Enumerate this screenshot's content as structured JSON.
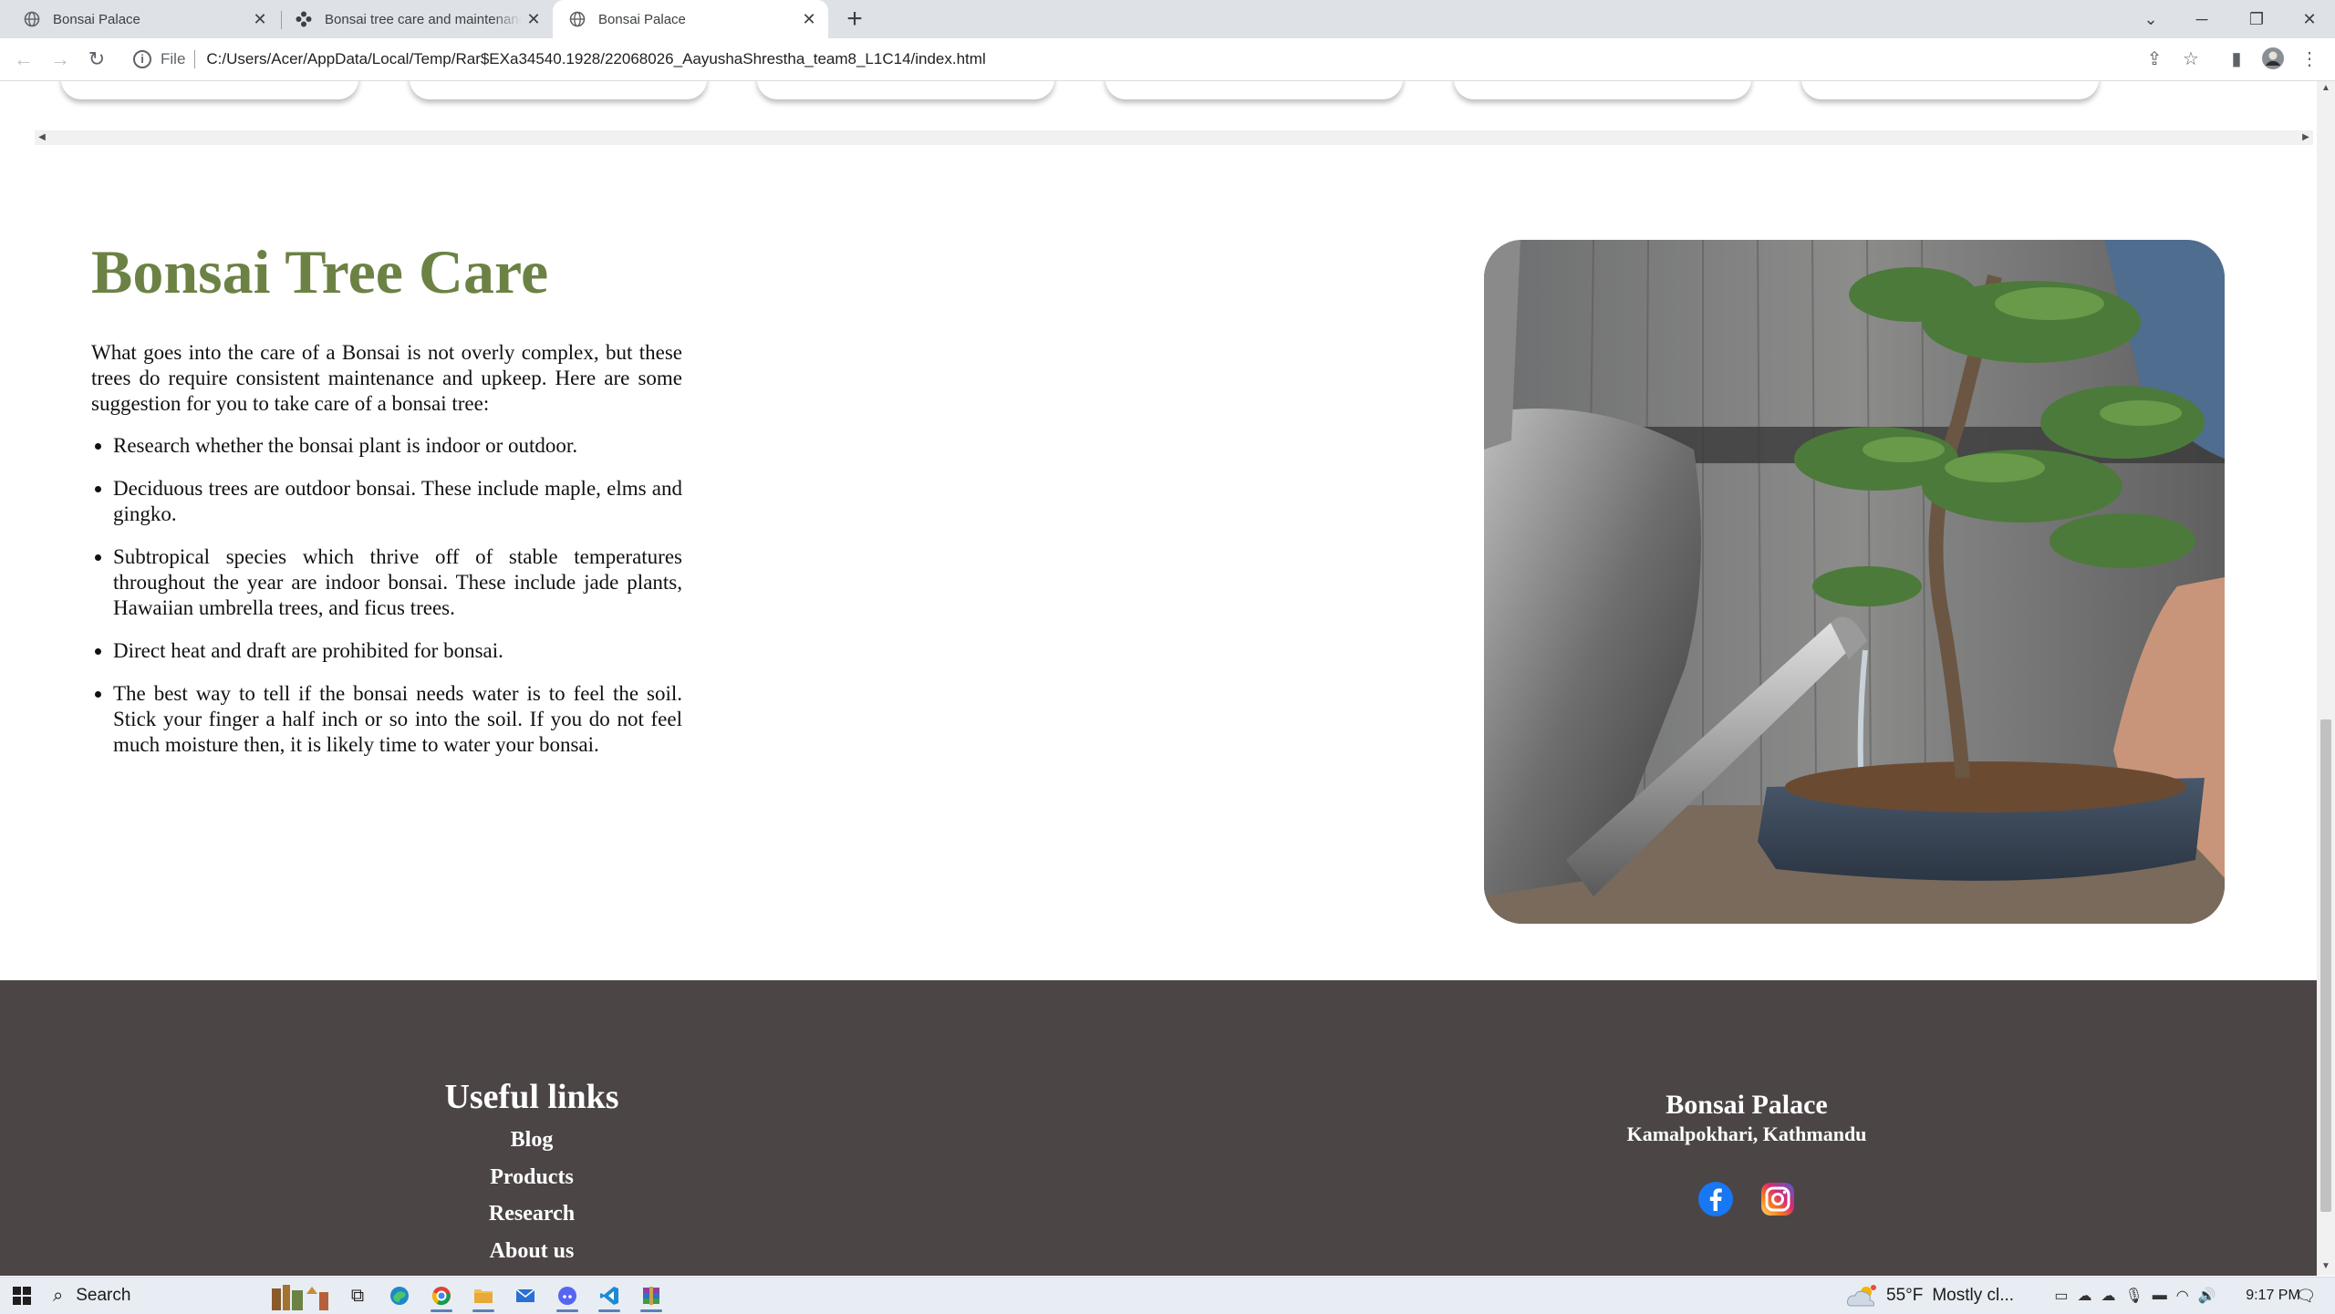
{
  "browser": {
    "tabs": [
      {
        "title": "Bonsai Palace",
        "active": false
      },
      {
        "title": "Bonsai tree care and maintenance",
        "active": false
      },
      {
        "title": "Bonsai Palace",
        "active": true
      }
    ],
    "new_tab_label": "+",
    "url_scheme": "File",
    "url": "C:/Users/Acer/AppData/Local/Temp/Rar$EXa34540.1928/22068026_AayushaShrestha_team8_L1C14/index.html"
  },
  "care": {
    "title": "Bonsai Tree Care",
    "intro": "What goes into the care of a Bonsai is not overly complex, but these trees do require consistent maintenance and upkeep. Here are some suggestion for you to take care of a bonsai tree:",
    "tips": [
      "Research whether the bonsai plant is indoor or outdoor.",
      "Deciduous trees are outdoor bonsai. These include maple, elms and gingko.",
      "Subtropical species which thrive off of stable temperatures throughout the year are indoor bonsai. These include jade plants, Hawaiian umbrella trees, and ficus trees.",
      "Direct heat and draft are prohibited for bonsai.",
      "The best way to tell if the bonsai needs water is to feel the soil. Stick your finger a half inch or so into the soil. If you do not feel much moisture then, it is likely time to water your bonsai."
    ]
  },
  "footer": {
    "links_heading": "Useful links",
    "links": [
      "Blog",
      "Products",
      "Research",
      "About us"
    ],
    "brand": "Bonsai Palace",
    "address": "Kamalpokhari, Kathmandu",
    "social": [
      "facebook-icon",
      "instagram-icon"
    ],
    "bg_color": "#4b4546"
  },
  "taskbar": {
    "search_label": "Search",
    "weather": "55°F",
    "weather_desc": "Mostly cl...",
    "time": "9:17 PM"
  }
}
